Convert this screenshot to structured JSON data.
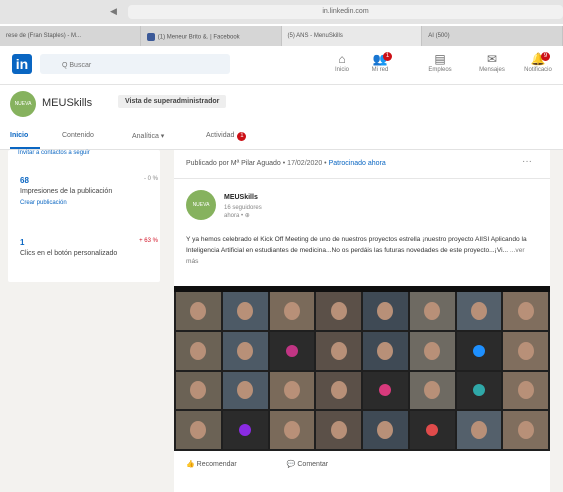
{
  "browser": {
    "url": "in.linkedin.com",
    "back_label": "◀",
    "tabs": [
      {
        "label": "rese de (Fran Staples) - M..."
      },
      {
        "label": "(1) Meneur Brito &. | Facebook"
      },
      {
        "label": "(5) ANS - MenuSkills"
      },
      {
        "label": "AI (500)"
      }
    ]
  },
  "linkedin": {
    "logo": "in",
    "search_placeholder": "Q Buscar",
    "nav": [
      {
        "icon": "home-icon",
        "label": "Inicio",
        "badge": ""
      },
      {
        "icon": "network-icon",
        "label": "Mi red",
        "badge": "1"
      },
      {
        "icon": "jobs-icon",
        "label": "Empleos",
        "badge": ""
      },
      {
        "icon": "messaging-icon",
        "label": "Mensajes",
        "badge": ""
      },
      {
        "icon": "notifications-icon",
        "label": "Notificacio",
        "badge": "9"
      }
    ]
  },
  "page": {
    "name": "MEUSkills",
    "avatar_text": "NUEVA",
    "admin_label": "Vista de superadministrador"
  },
  "subnav": {
    "items": [
      "Inicio",
      "Contenido",
      "Analítica ▾",
      "Actividad"
    ],
    "activity_badge": "1"
  },
  "left_card": {
    "cut_link": "Invitar a contactos a seguir",
    "stats": [
      {
        "value": "68",
        "change": "- 0 %",
        "change_color": "#888888",
        "label": "Impresiones de la publicación",
        "link": "Crear publicación"
      },
      {
        "value": "1",
        "change": "+ 63 %",
        "change_color": "#d11124",
        "label": "Clics en el botón personalizado",
        "link": ""
      }
    ]
  },
  "post": {
    "published_by": "Publicado por Mª Pilar Aguado",
    "date": "17/02/2020",
    "promoted": "Patrocinado ahora",
    "menu": "···",
    "author": "MEUSkills",
    "author_avatar_text": "NUEVA",
    "followers": "16 seguidores",
    "time": "ahora • ⊕",
    "text": "Y ya hemos celebrado el Kick Off Meeting de uno de nuestros proyectos estrella ¡nuestro proyecto AIISI Aplicando la Inteligencia Artificial en estudiantes de medicina...No os perdáis las futuras novedades de este proyecto...¡Vi...",
    "see_more": "...ver más",
    "actions": {
      "recommend": "Recomendar",
      "comment": "Comentar"
    }
  },
  "video": {
    "participants": [
      "p",
      "p",
      "p",
      "p",
      "p",
      "p",
      "p",
      "p",
      "p",
      "p",
      "a",
      "p",
      "p",
      "p",
      "a",
      "p",
      "p",
      "p",
      "p",
      "p",
      "a",
      "p",
      "a",
      "p",
      "p",
      "a",
      "p",
      "p",
      "p",
      "a",
      "p",
      "p"
    ],
    "dot_colors": [
      "#c13584",
      "#1e90ff",
      "#d83a7c",
      "#2fa8a8",
      "#8a2be2",
      "#e04b4b"
    ]
  }
}
